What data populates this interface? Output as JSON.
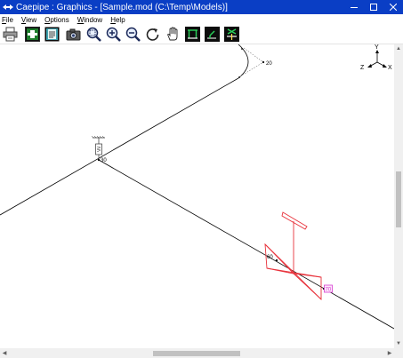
{
  "window": {
    "title": "Caepipe : Graphics -  [Sample.mod (C:\\Temp\\Models)]",
    "app_icon": "caepipe-logo-icon",
    "controls": [
      "minimize-icon",
      "maximize-icon",
      "close-icon"
    ]
  },
  "menu": {
    "items": [
      {
        "label": "File"
      },
      {
        "label": "View"
      },
      {
        "label": "Options"
      },
      {
        "label": "Window"
      },
      {
        "label": "Help"
      }
    ]
  },
  "toolbar": {
    "buttons": [
      {
        "name": "print-button",
        "icon": "printer-icon"
      },
      {
        "name": "show-model-button",
        "icon": "model-view-icon"
      },
      {
        "name": "show-list-button",
        "icon": "list-view-icon"
      },
      {
        "name": "snapshot-button",
        "icon": "camera-icon"
      },
      {
        "name": "zoom-window-button",
        "icon": "zoom-window-icon"
      },
      {
        "name": "zoom-in-button",
        "icon": "zoom-in-icon"
      },
      {
        "name": "zoom-out-button",
        "icon": "zoom-out-icon"
      },
      {
        "name": "rotate-button",
        "icon": "rotate-icon"
      },
      {
        "name": "pan-button",
        "icon": "hand-icon"
      },
      {
        "name": "view-front-button",
        "icon": "view-front-icon"
      },
      {
        "name": "view-iso-button",
        "icon": "view-iso-icon"
      },
      {
        "name": "view-top-button",
        "icon": "view-top-icon"
      }
    ]
  },
  "model": {
    "nodes": [
      {
        "label": "20"
      },
      {
        "label": "30"
      },
      {
        "label": "60"
      },
      {
        "label": "70",
        "highlighted": true
      }
    ],
    "triad": {
      "x": "X",
      "y": "Y",
      "z": "Z"
    },
    "colors": {
      "pipe": "#000000",
      "selection": "#e8333c",
      "highlight_box": "#d63bd1"
    }
  },
  "scrollbars": {
    "vertical_icon_up": "▲",
    "vertical_icon_down": "▼",
    "horizontal_icon_left": "◀",
    "horizontal_icon_right": "▶"
  }
}
